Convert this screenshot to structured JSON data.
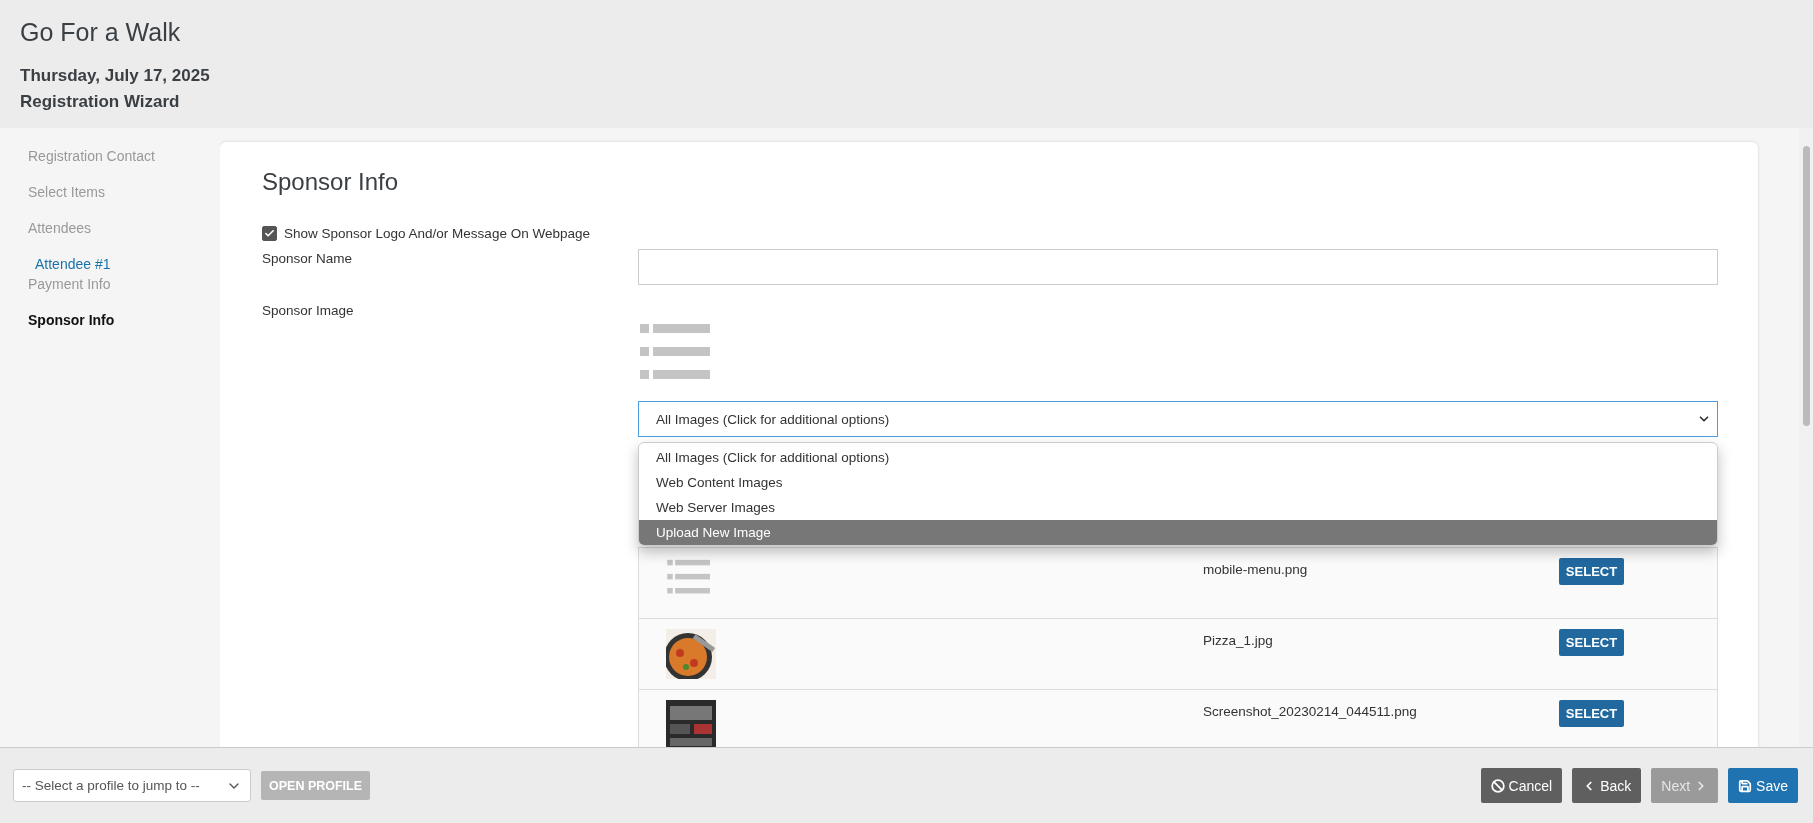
{
  "header": {
    "title": "Go For a Walk",
    "date": "Thursday, July 17, 2025",
    "subtitle": "Registration Wizard"
  },
  "sidebar": {
    "items": [
      {
        "label": "Registration Contact",
        "selected": false,
        "kind": "step"
      },
      {
        "label": "Select Items",
        "selected": false,
        "kind": "step"
      },
      {
        "label": "Attendees",
        "selected": false,
        "kind": "step"
      },
      {
        "label": "Attendee #1",
        "selected": false,
        "kind": "sub"
      },
      {
        "label": "Payment Info",
        "selected": false,
        "kind": "step"
      },
      {
        "label": "Sponsor Info",
        "selected": true,
        "kind": "step"
      }
    ]
  },
  "form": {
    "title": "Sponsor Info",
    "show_logo": {
      "label": "Show Sponsor Logo And/or Message On Webpage",
      "checked": true
    },
    "sponsor_name": {
      "label": "Sponsor Name"
    },
    "sponsor_image": {
      "label": "Sponsor Image",
      "source": {
        "value": "All Images (Click for additional options)",
        "expanded": true,
        "options": [
          {
            "label": "All Images (Click for additional options)",
            "highlighted": false
          },
          {
            "label": "Web Content Images",
            "highlighted": false
          },
          {
            "label": "Web Server Images",
            "highlighted": false
          },
          {
            "label": "Upload New Image",
            "highlighted": true
          }
        ]
      },
      "images": [
        {
          "kind": "list",
          "file": "mobile-menu.png",
          "action": "SELECT"
        },
        {
          "kind": "picture",
          "file": "Pizza_1.jpg",
          "action": "SELECT"
        },
        {
          "kind": "picture",
          "file": "Screenshot_20230214_044511.png",
          "action": "SELECT"
        }
      ]
    }
  },
  "footer": {
    "profile_select": {
      "placeholder": "-- Select a profile to jump to --"
    },
    "open_profile": {
      "label": "OPEN PROFILE",
      "disabled": true
    },
    "buttons": [
      {
        "kind": "cancel",
        "label": "Cancel",
        "disabled": false
      },
      {
        "kind": "back",
        "label": "Back",
        "disabled": false
      },
      {
        "kind": "next",
        "label": "Next",
        "disabled": true
      },
      {
        "kind": "save",
        "label": "Save",
        "disabled": false
      }
    ]
  }
}
